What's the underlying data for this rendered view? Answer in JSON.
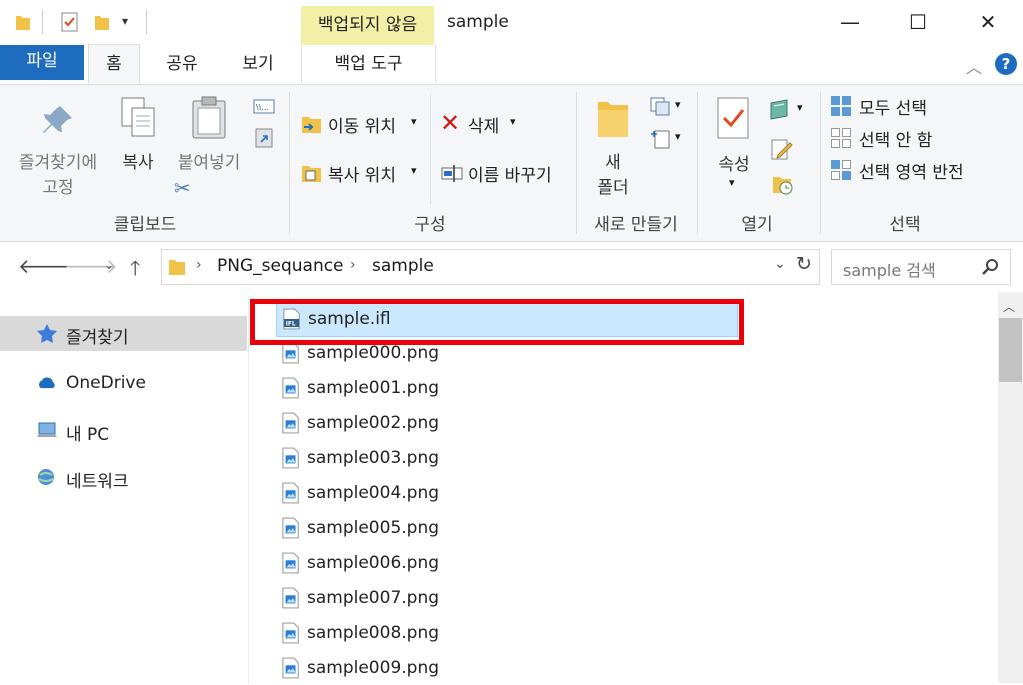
{
  "window": {
    "title": "sample",
    "context_tab_top": "백업되지 않음",
    "minimize": "—",
    "maximize": "☐",
    "close": "✕"
  },
  "tabs": {
    "file": "파일",
    "home": "홈",
    "share": "공유",
    "view": "보기",
    "backup_tools": "백업 도구"
  },
  "ribbon": {
    "clipboard": {
      "pin_label_1": "즐겨찾기에",
      "pin_label_2": "고정",
      "copy": "복사",
      "paste": "붙여넣기",
      "group": "클립보드"
    },
    "organize": {
      "move_to": "이동 위치",
      "copy_to": "복사 위치",
      "delete": "삭제",
      "rename": "이름 바꾸기",
      "group": "구성"
    },
    "new": {
      "new_folder_1": "새",
      "new_folder_2": "폴더",
      "group": "새로 만들기"
    },
    "open": {
      "properties": "속성",
      "group": "열기"
    },
    "select": {
      "select_all": "모두 선택",
      "select_none": "선택 안 함",
      "invert": "선택 영역 반전",
      "group": "선택"
    }
  },
  "address": {
    "crumb1": "PNG_sequance",
    "crumb2": "sample",
    "search_placeholder": "sample 검색"
  },
  "sidebar": {
    "items": [
      {
        "label": "즐겨찾기"
      },
      {
        "label": "OneDrive"
      },
      {
        "label": "내 PC"
      },
      {
        "label": "네트워크"
      }
    ]
  },
  "files": [
    {
      "name": "sample.ifl",
      "type": "ifl"
    },
    {
      "name": "sample000.png",
      "type": "png"
    },
    {
      "name": "sample001.png",
      "type": "png"
    },
    {
      "name": "sample002.png",
      "type": "png"
    },
    {
      "name": "sample003.png",
      "type": "png"
    },
    {
      "name": "sample004.png",
      "type": "png"
    },
    {
      "name": "sample005.png",
      "type": "png"
    },
    {
      "name": "sample006.png",
      "type": "png"
    },
    {
      "name": "sample007.png",
      "type": "png"
    },
    {
      "name": "sample008.png",
      "type": "png"
    },
    {
      "name": "sample009.png",
      "type": "png"
    }
  ],
  "colors": {
    "accent": "#1e6cc0",
    "selection": "#cce8ff",
    "highlight_box": "#e8000b",
    "context_tab": "#f2f0a6"
  }
}
